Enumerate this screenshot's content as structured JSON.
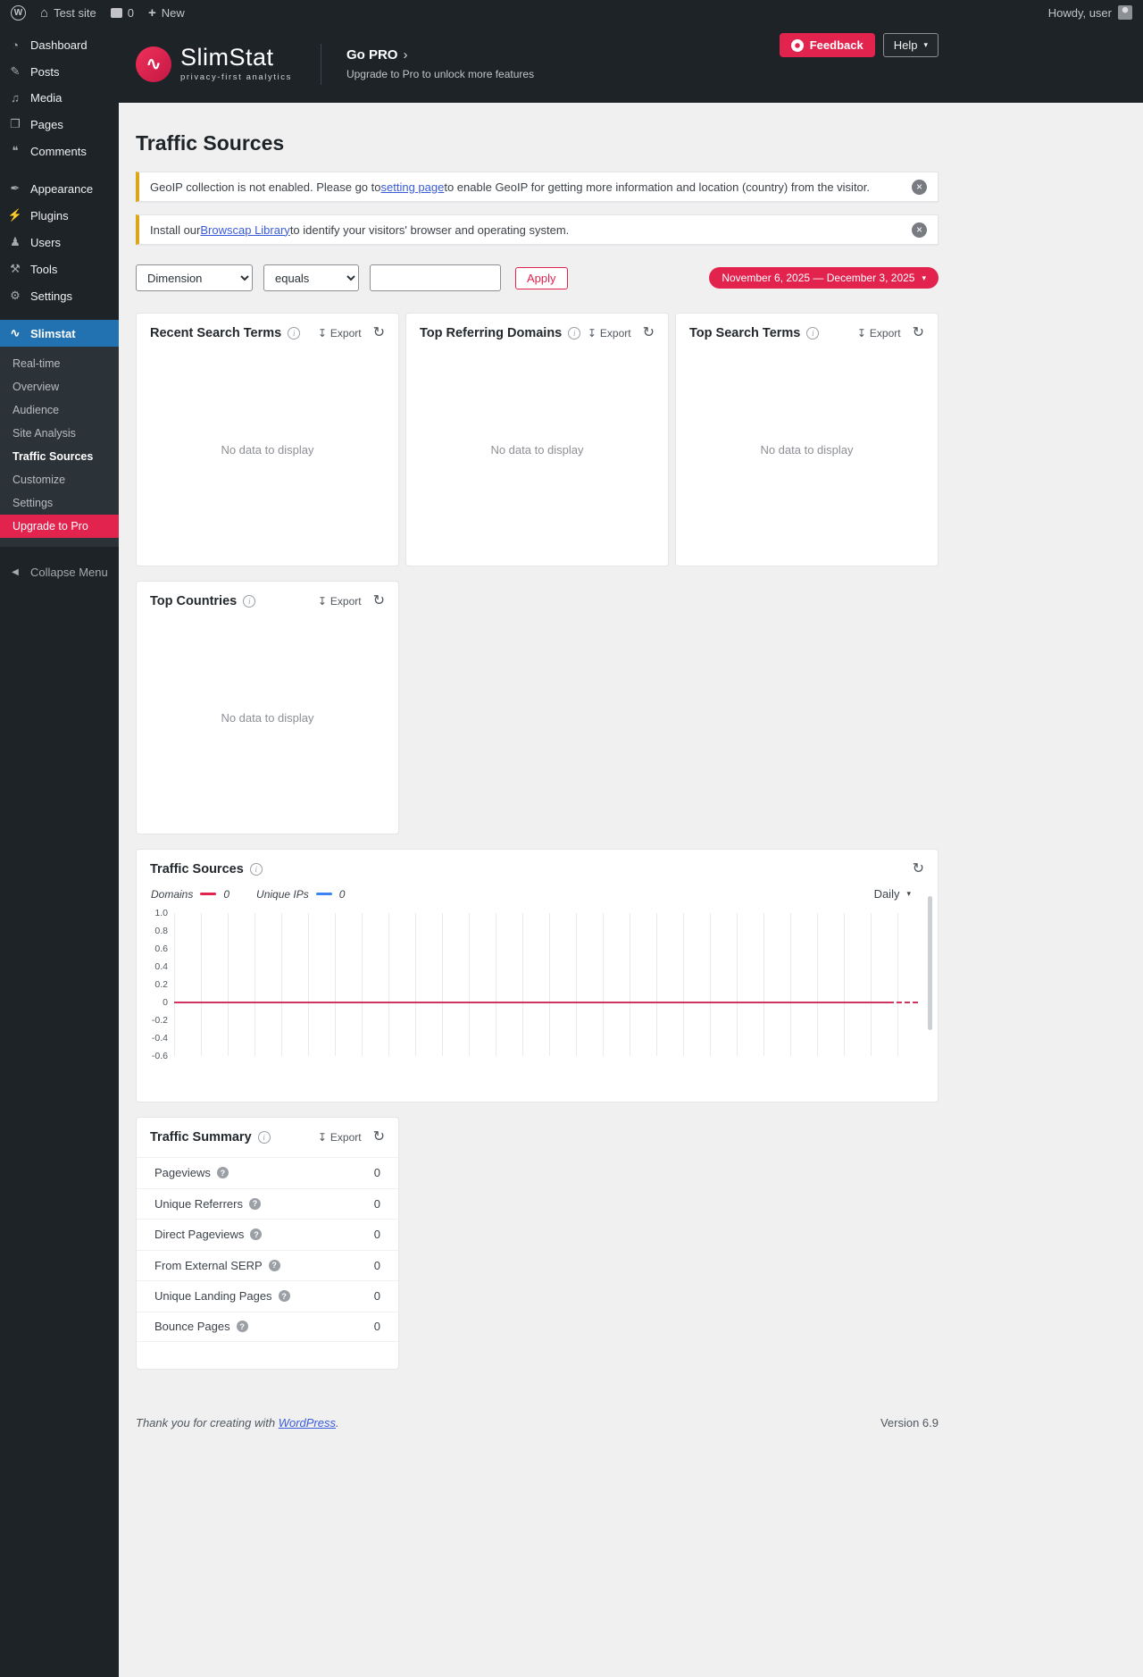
{
  "icons": {
    "info": "i",
    "question": "?",
    "close": "×",
    "export": "↧",
    "refresh": "↻",
    "caret": "▾",
    "chevron_right": "›",
    "wordpress": "W",
    "home": "⌂",
    "plus": "+",
    "collapse": "◀"
  },
  "colors": {
    "accent": "#e2234e",
    "active_menu": "#2271b1",
    "warning_border": "#dba617",
    "link": "#3a5bd9",
    "chart_line": "#cf3360"
  },
  "admin_bar": {
    "site_name": "Test site",
    "comment_count": "0",
    "new_label": "New",
    "howdy": "Howdy, user"
  },
  "header": {
    "brand_name": "SlimStat",
    "brand_tagline": "privacy-first analytics",
    "go_pro_label": "Go PRO",
    "go_pro_subtitle": "Upgrade to Pro to unlock more features",
    "feedback_label": "Feedback",
    "help_label": "Help"
  },
  "sidebar": {
    "items": [
      {
        "label": "Dashboard",
        "icon": "◔"
      },
      {
        "label": "Posts",
        "icon": "✎"
      },
      {
        "label": "Media",
        "icon": "♫"
      },
      {
        "label": "Pages",
        "icon": "❐"
      },
      {
        "label": "Comments",
        "icon": "❝"
      },
      {
        "label": "Appearance",
        "icon": "✒"
      },
      {
        "label": "Plugins",
        "icon": "⚡"
      },
      {
        "label": "Users",
        "icon": "♟"
      },
      {
        "label": "Tools",
        "icon": "⚒"
      },
      {
        "label": "Settings",
        "icon": "⚙"
      },
      {
        "label": "Slimstat",
        "icon": "∿"
      }
    ],
    "submenu": [
      {
        "label": "Real-time"
      },
      {
        "label": "Overview"
      },
      {
        "label": "Audience"
      },
      {
        "label": "Site Analysis"
      },
      {
        "label": "Traffic Sources"
      },
      {
        "label": "Customize"
      },
      {
        "label": "Settings"
      },
      {
        "label": "Upgrade to Pro"
      }
    ],
    "collapse_label": "Collapse Menu"
  },
  "page": {
    "title": "Traffic Sources",
    "notices": [
      {
        "before": "GeoIP collection is not enabled. Please go to ",
        "link": "setting page",
        "after": " to enable GeoIP for getting more information and location (country) from the visitor."
      },
      {
        "before": "Install our ",
        "link": "Browscap Library",
        "after": " to identify your visitors' browser and operating system."
      }
    ],
    "filters": {
      "dimension_value": "Dimension",
      "operator_value": "equals",
      "input_value": "",
      "apply_label": "Apply",
      "date_range_label": "November 6, 2025 — December 3, 2025"
    },
    "export_label": "Export",
    "empty_message": "No data to display",
    "cards": {
      "recent_search_terms": {
        "title": "Recent Search Terms"
      },
      "top_referring_domains": {
        "title": "Top Referring Domains"
      },
      "top_search_terms": {
        "title": "Top Search Terms"
      },
      "top_countries": {
        "title": "Top Countries"
      }
    },
    "traffic_summary": {
      "title": "Traffic Summary",
      "rows": [
        {
          "label": "Pageviews",
          "value": "0"
        },
        {
          "label": "Unique Referrers",
          "value": "0"
        },
        {
          "label": "Direct Pageviews",
          "value": "0"
        },
        {
          "label": "From External SERP",
          "value": "0"
        },
        {
          "label": "Unique Landing Pages",
          "value": "0"
        },
        {
          "label": "Bounce Pages",
          "value": "0"
        }
      ]
    }
  },
  "chart_data": {
    "type": "line",
    "title": "Traffic Sources",
    "interval": "Daily",
    "x_range": [
      "November 6, 2025",
      "December 3, 2025"
    ],
    "days": 28,
    "series": [
      {
        "name": "Domains",
        "color": "#e2234e",
        "total": "0",
        "values": [
          0,
          0,
          0,
          0,
          0,
          0,
          0,
          0,
          0,
          0,
          0,
          0,
          0,
          0,
          0,
          0,
          0,
          0,
          0,
          0,
          0,
          0,
          0,
          0,
          0,
          0,
          0,
          0
        ]
      },
      {
        "name": "Unique IPs",
        "color": "#3b82f6",
        "total": "0",
        "values": [
          0,
          0,
          0,
          0,
          0,
          0,
          0,
          0,
          0,
          0,
          0,
          0,
          0,
          0,
          0,
          0,
          0,
          0,
          0,
          0,
          0,
          0,
          0,
          0,
          0,
          0,
          0,
          0
        ]
      }
    ],
    "y_tick_labels": [
      "1.0",
      "0.8",
      "0.6",
      "0.4",
      "0.2",
      "0",
      "-0.2",
      "-0.4",
      "-0.6"
    ],
    "ylim": [
      -0.6,
      1.0
    ],
    "grid": "vertical",
    "legend_position": "top-left"
  },
  "footer": {
    "thanks_before": "Thank you for creating with ",
    "thanks_link": "WordPress",
    "thanks_after": ".",
    "version": "Version 6.9"
  }
}
